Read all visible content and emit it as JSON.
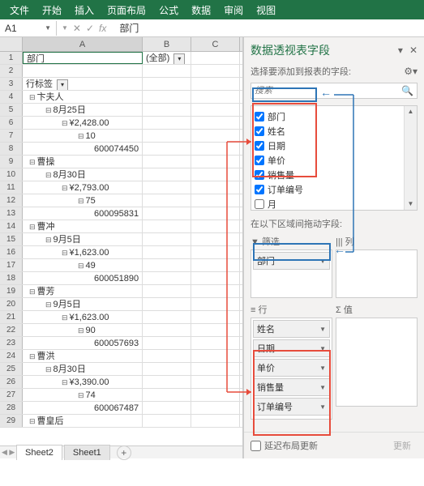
{
  "ribbon": {
    "tabs": [
      "文件",
      "开始",
      "插入",
      "页面布局",
      "公式",
      "数据",
      "审阅",
      "视图"
    ]
  },
  "nameBox": "A1",
  "formulaBarValue": "部门",
  "columns": [
    "A",
    "B",
    "C"
  ],
  "rows": [
    {
      "n": 1,
      "a": "部门",
      "b": "(全部)",
      "dropA": false,
      "dropB": true,
      "active": true
    },
    {
      "n": 2,
      "a": "",
      "b": ""
    },
    {
      "n": 3,
      "a": "行标签",
      "b": "",
      "dropA": true,
      "indent": 0
    },
    {
      "n": 4,
      "a": "卞夫人",
      "indent": 1,
      "collapse": true
    },
    {
      "n": 5,
      "a": "8月25日",
      "indent": 2,
      "collapse": true
    },
    {
      "n": 6,
      "a": "¥2,428.00",
      "indent": 3,
      "collapse": true
    },
    {
      "n": 7,
      "a": "10",
      "indent": 4,
      "collapse": true
    },
    {
      "n": 8,
      "a": "600074450",
      "indent": 5
    },
    {
      "n": 9,
      "a": "曹操",
      "indent": 1,
      "collapse": true
    },
    {
      "n": 10,
      "a": "8月30日",
      "indent": 2,
      "collapse": true
    },
    {
      "n": 11,
      "a": "¥2,793.00",
      "indent": 3,
      "collapse": true
    },
    {
      "n": 12,
      "a": "75",
      "indent": 4,
      "collapse": true
    },
    {
      "n": 13,
      "a": "600095831",
      "indent": 5
    },
    {
      "n": 14,
      "a": "曹冲",
      "indent": 1,
      "collapse": true
    },
    {
      "n": 15,
      "a": "9月5日",
      "indent": 2,
      "collapse": true
    },
    {
      "n": 16,
      "a": "¥1,623.00",
      "indent": 3,
      "collapse": true
    },
    {
      "n": 17,
      "a": "49",
      "indent": 4,
      "collapse": true
    },
    {
      "n": 18,
      "a": "600051890",
      "indent": 5
    },
    {
      "n": 19,
      "a": "曹芳",
      "indent": 1,
      "collapse": true
    },
    {
      "n": 20,
      "a": "9月5日",
      "indent": 2,
      "collapse": true
    },
    {
      "n": 21,
      "a": "¥1,623.00",
      "indent": 3,
      "collapse": true
    },
    {
      "n": 22,
      "a": "90",
      "indent": 4,
      "collapse": true
    },
    {
      "n": 23,
      "a": "600057693",
      "indent": 5
    },
    {
      "n": 24,
      "a": "曹洪",
      "indent": 1,
      "collapse": true
    },
    {
      "n": 25,
      "a": "8月30日",
      "indent": 2,
      "collapse": true
    },
    {
      "n": 26,
      "a": "¥3,390.00",
      "indent": 3,
      "collapse": true
    },
    {
      "n": 27,
      "a": "74",
      "indent": 4,
      "collapse": true
    },
    {
      "n": 28,
      "a": "600067487",
      "indent": 5
    },
    {
      "n": 29,
      "a": "曹皇后",
      "indent": 1,
      "collapse": true
    }
  ],
  "sheetTabs": {
    "active": "Sheet2",
    "other": "Sheet1"
  },
  "pivot": {
    "title": "数据透视表字段",
    "subtitle": "选择要添加到报表的字段:",
    "searchPlaceholder": "搜索",
    "fields": [
      {
        "label": "部门",
        "checked": true
      },
      {
        "label": "姓名",
        "checked": true
      },
      {
        "label": "日期",
        "checked": true
      },
      {
        "label": "单价",
        "checked": true
      },
      {
        "label": "销售量",
        "checked": true
      },
      {
        "label": "订单编号",
        "checked": true
      },
      {
        "label": "月",
        "checked": false
      }
    ],
    "dragLabel": "在以下区域间拖动字段:",
    "zones": {
      "filter": {
        "title": "▼ 筛选",
        "items": [
          "部门"
        ]
      },
      "columns": {
        "title": "||| 列",
        "items": []
      },
      "rows": {
        "title": "≡ 行",
        "items": [
          "姓名",
          "日期",
          "单价",
          "销售量",
          "订单编号"
        ]
      },
      "values": {
        "title": "Σ 值",
        "items": []
      }
    },
    "deferLabel": "延迟布局更新",
    "updateBtn": "更新"
  }
}
